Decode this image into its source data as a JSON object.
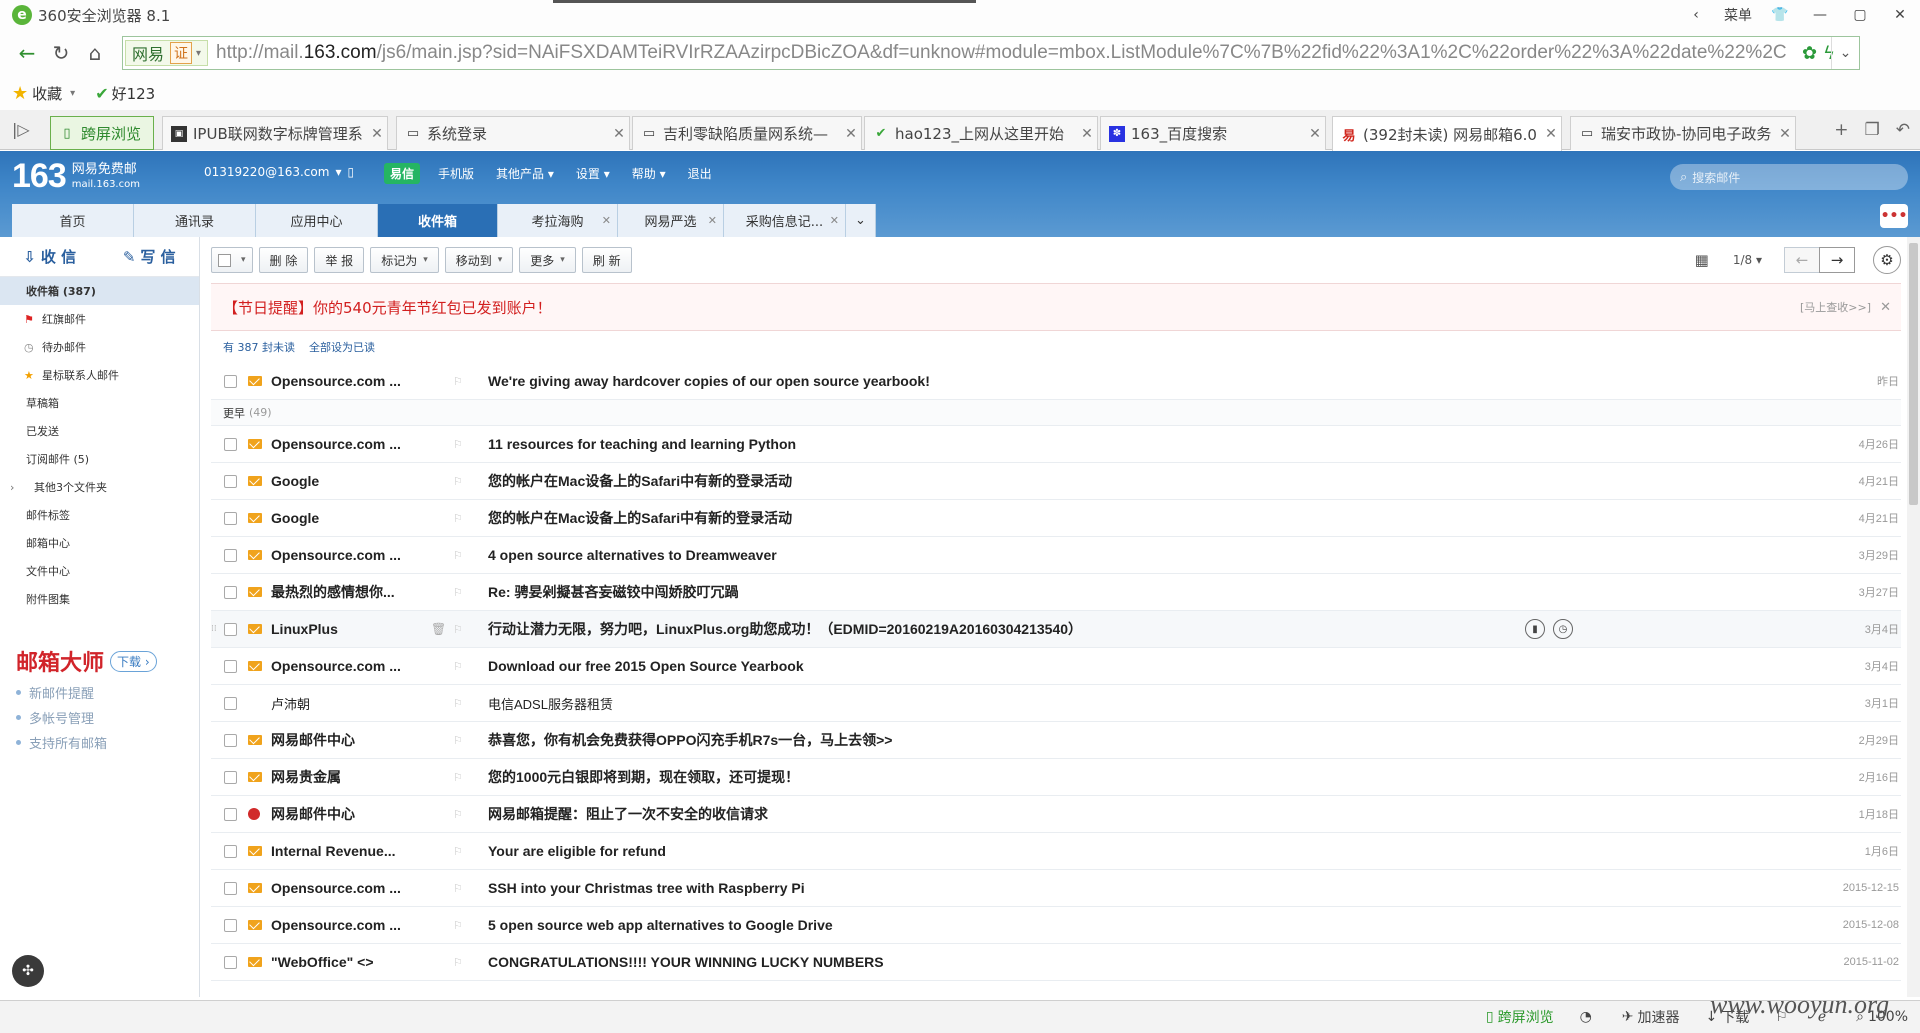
{
  "browser": {
    "title": "360安全浏览器 8.1",
    "controls": {
      "menu_label": "菜单",
      "back_arrow": "‹"
    },
    "address": {
      "site_label": "网易",
      "cert_label": "证",
      "url_prefix": "http://mail.",
      "url_domain": "163.com",
      "url_rest": "/js6/main.jsp?sid=NAiFSXDAMTeiRVIrRZAAzirpcDBicZOA&df=unknow#module=mbox.ListModule%7C%7B%22fid%22%3A1%2C%22order%22%3A%22date%22%2C"
    },
    "favorites": {
      "fav_label": "收藏",
      "hao_label": "好123"
    },
    "tabs": [
      {
        "label": "跨屏浏览",
        "icon": "phone-icon"
      },
      {
        "label": "IPUB联网数字标牌管理系",
        "icon": "app-icon"
      },
      {
        "label": "系统登录",
        "icon": "page-icon"
      },
      {
        "label": "吉利零缺陷质量网系统—",
        "icon": "page-icon"
      },
      {
        "label": "hao123_上网从这里开始",
        "icon": "hao-icon"
      },
      {
        "label": "163_百度搜索",
        "icon": "baidu-icon"
      },
      {
        "label": "(392封未读) 网易邮箱6.0",
        "icon": "netease-icon"
      },
      {
        "label": "瑞安市政协-协同电子政务",
        "icon": "page-icon"
      }
    ]
  },
  "mail": {
    "brand": {
      "logo_num": "163",
      "line1": "网易免费邮",
      "line2": "mail.163.com"
    },
    "account": "01319220@163.com",
    "header_links": {
      "yixin": "易信",
      "mobile": "手机版",
      "other": "其他产品",
      "settings": "设置",
      "help": "帮助",
      "logout": "退出"
    },
    "search_placeholder": "搜索邮件",
    "nav_tabs": [
      {
        "label": "首页"
      },
      {
        "label": "通讯录"
      },
      {
        "label": "应用中心"
      },
      {
        "label": "收件箱"
      },
      {
        "label": "考拉海购"
      },
      {
        "label": "网易严选"
      },
      {
        "label": "采购信息记..."
      }
    ],
    "sidebar": {
      "receive_label": "收 信",
      "compose_label": "写 信",
      "folders": [
        {
          "label": "收件箱 (387)"
        },
        {
          "label": "红旗邮件"
        },
        {
          "label": "待办邮件"
        },
        {
          "label": "星标联系人邮件"
        },
        {
          "label": "草稿箱"
        },
        {
          "label": "已发送"
        },
        {
          "label": "订阅邮件 (5)"
        },
        {
          "label": "其他3个文件夹"
        },
        {
          "label": "邮件标签"
        },
        {
          "label": "邮箱中心"
        },
        {
          "label": "文件中心"
        },
        {
          "label": "附件图集"
        }
      ],
      "master": {
        "title": "邮箱大师",
        "download": "下载",
        "items": [
          "新邮件提醒",
          "多帐号管理",
          "支持所有邮箱"
        ]
      }
    },
    "toolbar": {
      "delete": "删 除",
      "report": "举 报",
      "mark": "标记为",
      "move": "移动到",
      "more": "更多",
      "refresh": "刷 新",
      "page": "1/8"
    },
    "notice": {
      "text": "【节日提醒】你的540元青年节红包已发到账户！",
      "action": "[马上查收>>]"
    },
    "unread": {
      "count_text": "有 387 封未读",
      "mark_all": "全部设为已读"
    },
    "group_early": {
      "label": "更早",
      "count": "(49)"
    },
    "top_mail": {
      "sender": "Opensource.com ...",
      "subject": "We're giving away hardcover copies of our open source yearbook!",
      "date": "昨日"
    },
    "mails": [
      {
        "sender": "Opensource.com ...",
        "subject": "11 resources for teaching and learning Python",
        "date": "4月26日"
      },
      {
        "sender": "Google",
        "subject": "您的帐户在Mac设备上的Safari中有新的登录活动",
        "date": "4月21日"
      },
      {
        "sender": "Google",
        "subject": "您的帐户在Mac设备上的Safari中有新的登录活动",
        "date": "4月21日"
      },
      {
        "sender": "Opensource.com ...",
        "subject": "4 open source alternatives to Dreamweaver",
        "date": "3月29日"
      },
      {
        "sender": "最热烈的感情想你...",
        "subject": "Re: 骋妟剁擬甚吝妄磁铰中闯娇胶叮冗踻",
        "date": "3月27日"
      },
      {
        "sender": "LinuxPlus",
        "subject": "行动让潜力无限，努力吧，LinuxPlus.org助您成功！（EDMID=20160219A20160304213540）",
        "date": "3月4日"
      },
      {
        "sender": "Opensource.com ...",
        "subject": "Download our free 2015 Open Source Yearbook",
        "date": "3月4日"
      },
      {
        "sender": "卢沛朝",
        "subject": "电信ADSL服务器租赁",
        "date": "3月1日"
      },
      {
        "sender": "网易邮件中心",
        "subject": "恭喜您，你有机会免费获得OPPO闪充手机R7s一台，马上去领>>",
        "date": "2月29日"
      },
      {
        "sender": "网易贵金属",
        "subject": "您的1000元白银即将到期，现在领取，还可提现！",
        "date": "2月16日"
      },
      {
        "sender": "网易邮件中心",
        "subject": "网易邮箱提醒：阻止了一次不安全的收信请求",
        "date": "1月18日"
      },
      {
        "sender": "Internal Revenue...",
        "subject": "Your are eligible for refund",
        "date": "1月6日"
      },
      {
        "sender": "Opensource.com ...",
        "subject": "SSH into your Christmas tree with Raspberry Pi",
        "date": "2015-12-15"
      },
      {
        "sender": "Opensource.com ...",
        "subject": "5 open source web app alternatives to Google Drive",
        "date": "2015-12-08"
      },
      {
        "sender": "\"WebOffice\" <>",
        "subject": "CONGRATULATIONS!!!! YOUR WINNING LUCKY NUMBERS",
        "date": "2015-11-02"
      }
    ]
  },
  "statusbar": {
    "kuaping": "跨屏浏览",
    "accelerator": "加速器",
    "download": "下载",
    "zoom": "100%"
  },
  "watermark": "www.wooyun.org"
}
